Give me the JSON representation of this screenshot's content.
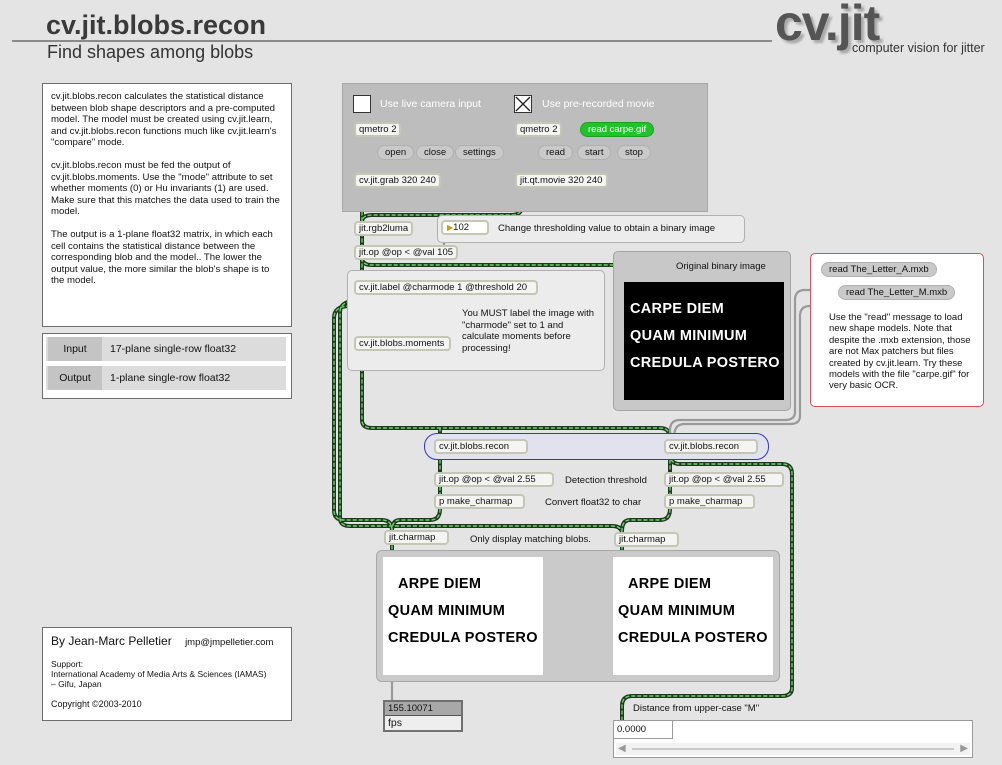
{
  "header": {
    "title": "cv.jit.blobs.recon",
    "subtitle": "Find shapes among blobs",
    "logo": "cv.jit",
    "logo_tagline": "computer vision for jitter"
  },
  "description": {
    "para1": "cv.jit.blobs.recon calculates the statistical distance between blob shape descriptors and a pre-computed model. The model must be created using cv.jit.learn, and cv.jit.blobs.recon functions much like cv.jit.learn's \"compare\" mode.",
    "para2": "cv.jit.blobs.recon must be fed the output of cv.jit.blobs.moments. Use the \"mode\" attribute to set whether moments (0) or Hu invariants (1) are used. Make sure that this matches the data used to train the model.",
    "para3": "The output is a 1-plane float32 matrix, in which each cell contains the statistical distance between the corresponding blob and the model.. The lower the output value, the more similar the blob's shape is to the model."
  },
  "io": {
    "input_label": "Input",
    "input_value": "17-plane single-row float32",
    "output_label": "Output",
    "output_value": "1-plane single-row float32"
  },
  "credits": {
    "author": "By Jean-Marc Pelletier",
    "email": "jmp@jmpelletier.com",
    "support_label": "Support:",
    "support_org": "International Academy of Media Arts & Sciences (IAMAS)",
    "support_loc": "– Gifu, Japan",
    "copyright": "Copyright ©2003-2010"
  },
  "inputs": {
    "live_label": "Use live camera input",
    "live_checked": false,
    "movie_label": "Use pre-recorded movie",
    "movie_checked": true,
    "qmetro_left": "qmetro 2",
    "qmetro_right": "qmetro 2",
    "read_carpe": "read carpe.gif",
    "read_carpe_color": "#22c22b",
    "open": "open",
    "close": "close",
    "settings": "settings",
    "read": "read",
    "start": "start",
    "stop": "stop",
    "grab": "cv.jit.grab 320 240",
    "qtmovie": "jit.qt.movie 320 240"
  },
  "pipeline": {
    "rgb2luma": "jit.rgb2luma",
    "threshold_value": "102",
    "threshold_comment": "Change thresholding value to obtain a binary image",
    "op_threshold": "jit.op @op < @val 105",
    "label": "cv.jit.label @charmode 1 @threshold 20",
    "moments": "cv.jit.blobs.moments",
    "label_note": "You MUST label the image with \"charmode\" set to 1 and calculate moments before processing!",
    "binary_title": "Original binary image",
    "binary_lines": [
      "CARPE DIEM",
      "QUAM MINIMUM",
      "CREDULA POSTERO"
    ]
  },
  "models": {
    "read_a": "read The_Letter_A.mxb",
    "read_m": "read The_Letter_M.mxb",
    "note": "Use the \"read\" message to load new shape models. Note that despite the .mxb extension, those are not Max patchers but files created by cv.jit.learn. Try these models with the file \"carpe.gif\" for very basic OCR."
  },
  "recon": {
    "left": "cv.jit.blobs.recon",
    "right": "cv.jit.blobs.recon",
    "op_left": "jit.op @op < @val 2.55",
    "op_right": "jit.op @op < @val 2.55",
    "detection_comment": "Detection threshold",
    "charmap_left_sub": "p make_charmap",
    "charmap_right_sub": "p make_charmap",
    "convert_comment": "Convert float32 to char",
    "charmap_left": "jit.charmap",
    "charmap_right": "jit.charmap",
    "display_comment": "Only display matching blobs.",
    "result_left": [
      "ARPE DIEM",
      "QUAM MINIMUM",
      "CREDULA POSTERO"
    ],
    "result_right": [
      "ARPE DIEM",
      "QUAM MINIMUM",
      "CREDULA POSTERO"
    ]
  },
  "fps": {
    "value": "155.10071",
    "label": "fps"
  },
  "distance": {
    "label": "Distance from upper-case \"M\"",
    "value": "0.0000"
  }
}
